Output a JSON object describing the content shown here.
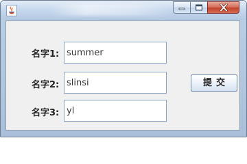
{
  "window": {
    "title": ""
  },
  "titlebar": {
    "icon": "java-coffee-icon",
    "buttons": [
      "minimize-icon",
      "maximize-icon",
      "close-icon"
    ]
  },
  "form": {
    "fields": [
      {
        "label": "名字1:",
        "value": "summer"
      },
      {
        "label": "名字2:",
        "value": "slinsi"
      },
      {
        "label": "名字3:",
        "value": "yl"
      }
    ],
    "submit_label": "提交"
  },
  "colors": {
    "titlebar_glass": "#c7d9ee",
    "client_bg": "#f0f0f0",
    "close_button": "#c2452f",
    "field_border": "#8aa3be"
  }
}
